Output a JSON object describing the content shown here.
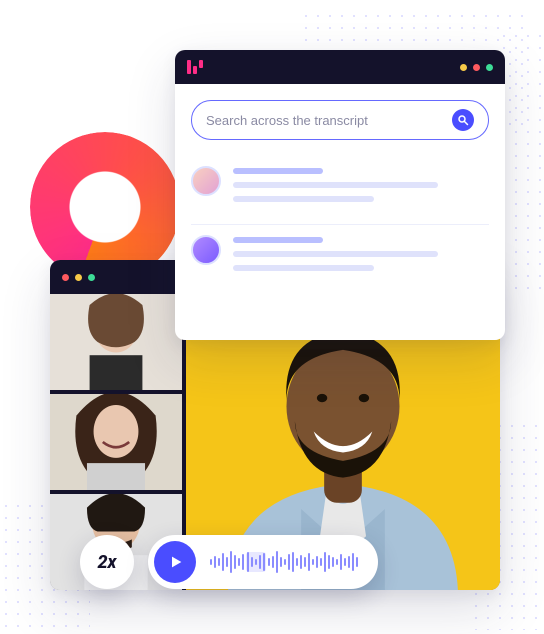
{
  "transcript_window": {
    "traffic_light_colors": [
      "#f7c948",
      "#ff5a5f",
      "#3ddc97"
    ],
    "search_placeholder": "Search across the transcript",
    "rows": [
      {
        "avatar": "a1"
      },
      {
        "avatar": "a2"
      }
    ]
  },
  "video_window": {
    "traffic_light_colors": [
      "#ff5a5f",
      "#f7c948",
      "#3ddc97"
    ]
  },
  "player": {
    "speed_label": "2x",
    "waveform_heights": [
      6,
      12,
      8,
      18,
      10,
      22,
      14,
      8,
      16,
      20,
      10,
      6,
      14,
      18,
      8,
      12,
      22,
      10,
      6,
      16,
      20,
      8,
      14,
      10,
      18,
      6,
      12,
      8,
      20,
      14,
      10,
      6,
      16,
      8,
      12,
      18,
      10
    ],
    "active_start": 9,
    "active_end": 13
  },
  "colors": {
    "accent": "#4a4dff",
    "titlebar": "#14122b",
    "brand_pink": "#ff2d87"
  }
}
